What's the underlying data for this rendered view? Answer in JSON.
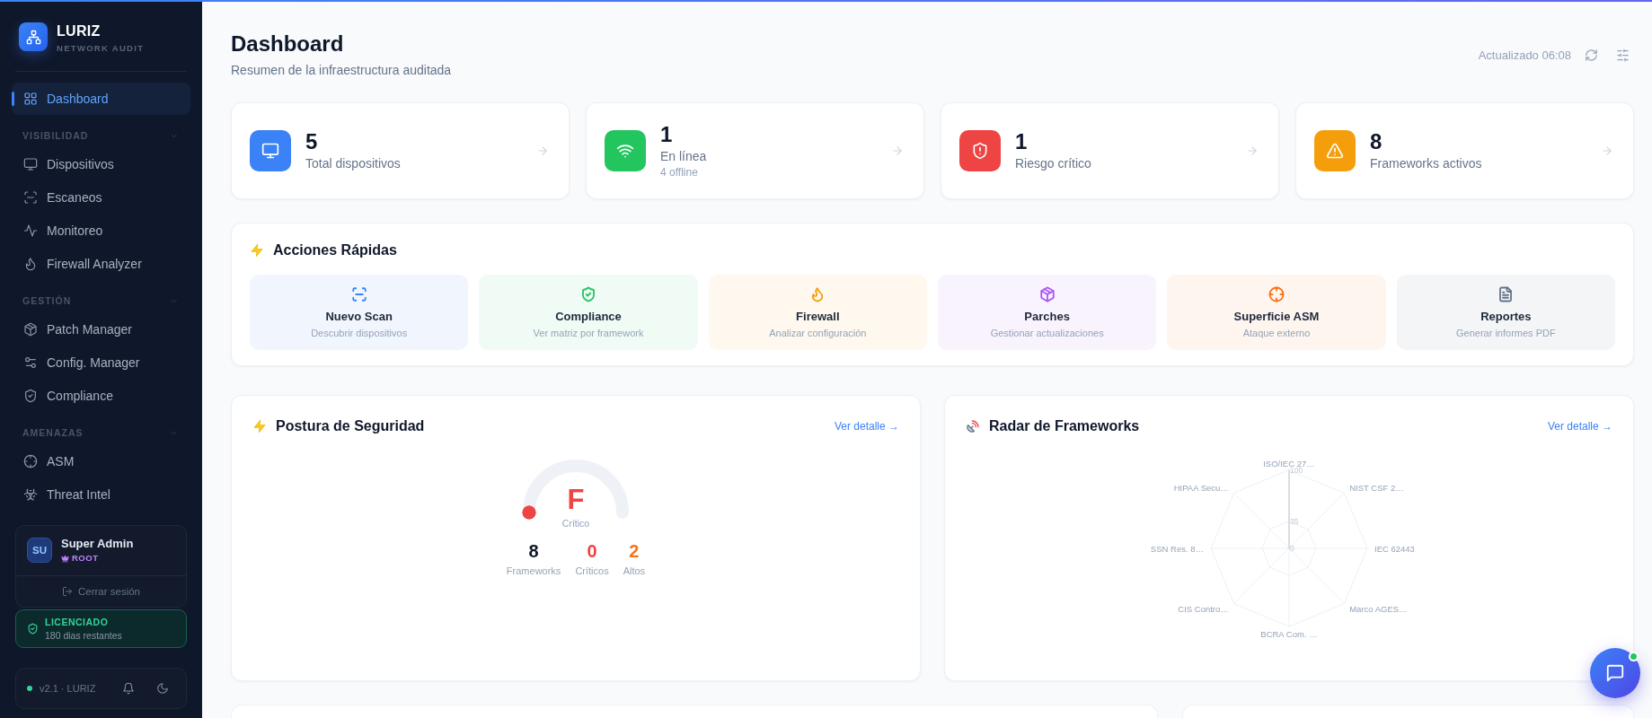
{
  "sidebar": {
    "brand": {
      "name": "LURIZ",
      "tagline": "NETWORK AUDIT"
    },
    "nav": [
      {
        "label": "Dashboard",
        "selected": true
      }
    ],
    "sections": [
      {
        "title": "VISIBILIDAD",
        "expanded": true,
        "items": [
          {
            "label": "Dispositivos",
            "selected": false
          },
          {
            "label": "Escaneos",
            "selected": false
          },
          {
            "label": "Monitoreo",
            "selected": false
          },
          {
            "label": "Firewall Analyzer",
            "selected": false
          }
        ]
      },
      {
        "title": "GESTIÓN",
        "expanded": true,
        "items": [
          {
            "label": "Patch Manager",
            "selected": false
          },
          {
            "label": "Config. Manager",
            "selected": false
          },
          {
            "label": "Compliance",
            "selected": false
          }
        ]
      },
      {
        "title": "AMENAZAS",
        "expanded": true,
        "items": [
          {
            "label": "ASM",
            "selected": false
          },
          {
            "label": "Threat Intel",
            "selected": false
          }
        ]
      }
    ],
    "user": {
      "initials": "SU",
      "name": "Super Admin",
      "role": "ROOT",
      "logout": "Cerrar sesión"
    },
    "license": {
      "status": "LICENCIADO",
      "detail": "180 dias restantes"
    },
    "footer": {
      "version": "v2.1 · LURIZ",
      "online": true
    }
  },
  "header": {
    "title": "Dashboard",
    "subtitle": "Resumen de la infraestructura auditada",
    "updated": "Actualizado 06:08"
  },
  "stats": [
    {
      "value": "5",
      "label": "Total dispositivos",
      "color": "#3b82f6"
    },
    {
      "value": "1",
      "label": "En línea",
      "note": "4 offline",
      "color": "#22c55e"
    },
    {
      "value": "1",
      "label": "Riesgo crítico",
      "color": "#ef4444"
    },
    {
      "value": "8",
      "label": "Frameworks activos",
      "color": "#f59e0b"
    }
  ],
  "quick_actions": {
    "title": "Acciones Rápidas",
    "actions": [
      {
        "label": "Nuevo Scan",
        "hint": "Descubrir dispositivos",
        "color": "#3b82f6"
      },
      {
        "label": "Compliance",
        "hint": "Ver matriz por framework",
        "color": "#22c55e"
      },
      {
        "label": "Firewall",
        "hint": "Analizar configuración",
        "color": "#f59e0b"
      },
      {
        "label": "Parches",
        "hint": "Gestionar actualizaciones",
        "color": "#a855f7"
      },
      {
        "label": "Superficie ASM",
        "hint": "Ataque externo",
        "color": "#f97316"
      },
      {
        "label": "Reportes",
        "hint": "Generar informes PDF",
        "color": "#64748b"
      }
    ]
  },
  "posture": {
    "title": "Postura de Seguridad",
    "link": "Ver detalle →",
    "gauge": {
      "grade": "F",
      "status": "Crítico",
      "level": 0
    },
    "stats": [
      {
        "value": "8",
        "label": "Frameworks",
        "color": "#0f172a"
      },
      {
        "value": "0",
        "label": "Críticos",
        "color": "#ef4444"
      },
      {
        "value": "2",
        "label": "Altos",
        "color": "#f97316"
      }
    ]
  },
  "radar": {
    "title": "Radar de Frameworks",
    "link": "Ver detalle →",
    "axes": [
      "ISO/IEC 27…",
      "NIST CSF 2…",
      "IEC 62443",
      "Marco AGES…",
      "BCRA Com. …",
      "CIS Contro…",
      "SSN Res. 8…",
      "HIPAA Secu…"
    ],
    "ticks": [
      "100",
      "35",
      "0"
    ]
  },
  "chat": {
    "online": true
  }
}
